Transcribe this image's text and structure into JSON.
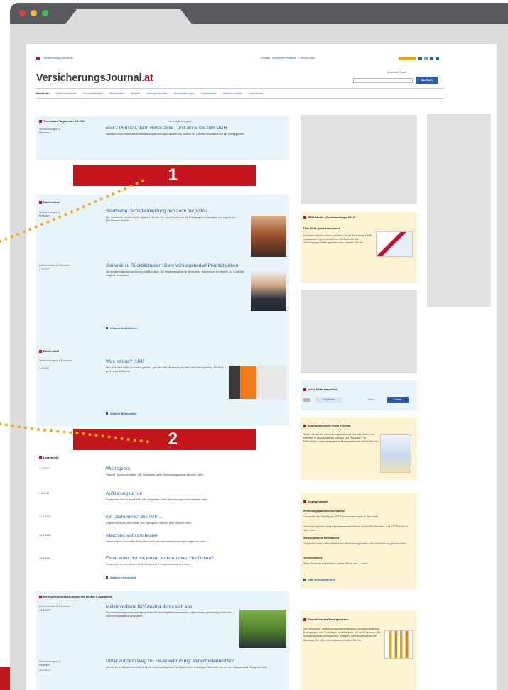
{
  "browser": {
    "dots": [
      "#e03c3c",
      "#f5b63a",
      "#3fbf55"
    ]
  },
  "site": {
    "logo_main": "VersicherungsJournal",
    "logo_suffix": ".at",
    "url_text": "VersicherungsJournal.de",
    "top_links": "Kontakt   Newsletter bestellen   Premium-Abo",
    "nav": [
      "Startseite",
      "Themenbereiche",
      "Pressestimmen",
      "Bilder/Video",
      "Bücher",
      "Anzeigenmärkte",
      "Veranstaltungen",
      "Originaltexte",
      "Weitere Inhalte",
      "Leserbriefe"
    ],
    "search_button": "Suchen",
    "search_hint": "Erweiterte Suche"
  },
  "theme_of_day": {
    "header": "Thema des Tages vom 3.2.2017",
    "header_link": "vorherige Ausgabe",
    "category": "Versicherungen & Finanzen",
    "title": "Erst 1 Pension, dann Reha-Geld – und am Ende zum OGH",
    "text": "Nachdem einem Mann das Rehabilitationsgeld entzogen worden war, musste der Oberste Gerichtshof nun ein Stichtag prüfen."
  },
  "markers": [
    "1",
    "2"
  ],
  "news": {
    "header": "Nachrichten",
    "items": [
      {
        "category": "Versicherungen & Finanzen",
        "title": "Städtische: Schadenmeldung nun auch per Video",
        "text": "Der Versicherer erweitert seine digitalen Dienste. Der neue Service soll die Erledigung beschleunigen und ergänzt den persönlichen Kontakt."
      },
      {
        "category": "Unternehmen & Personen",
        "date": "3.2.2017",
        "title": "Generali zu Rückbildbedarf: Dem Vorsorgebedarf Priorität geben",
        "text": "Die jüngste Kalkulationsrechnung und Rückblick. Die Regierungspläne für Versicherer. Neuerungen im Vertrieb 2017 und eine mögliche Konkurrenz."
      }
    ],
    "more": "Weitere Nachrichten"
  },
  "riddle": {
    "header": "Bilderrätsel",
    "category": "Versicherungen & Finanzen",
    "date": "1.2.2017",
    "title": "Was ist das? (184)",
    "text": "Hier sind keine Bilder zu erraten gekauft – gesucht wird aber etwas aus dem Versicherungsalltag. Per Klick geht es zur Auflösung.",
    "more": "Weitere Bilderrätsel"
  },
  "letters": {
    "header": "Leserbriefe",
    "items": [
      {
        "date": "1.2.2017",
        "title": "Wichtigeres",
        "text": "Gesucht: Suche zum Artikel „Wir: Bürgerliste sollen Versicherungsschutz anbieten“ mehr …"
      },
      {
        "date": "1.2.2017",
        "title": "Aufklärung tut not",
        "text": "Ergebnisse: Lindner zum Artikel „Wir: Bürgerliste sollen Versicherungsschutz anbieten“ mehr …"
      },
      {
        "date": "31.1.2017",
        "title": "Ein „Geheimnis“ des VAV ...",
        "text": "Engelbert Kreuzer zum Artikel „VAV: Bausparen Jahrin in jeder Hinsicht“ mehr …"
      },
      {
        "date": "30.1.2017",
        "title": "Abschied wohl am besten",
        "text": "Hannes Hesch zum Artikel „Rücktrittsrecht: Erste Gerichtsentscheidungen liegen vor“ mehr …"
      },
      {
        "date": "30.1.2017",
        "title": "Einen alten Hut mit einem anderen alten Hut flicken?",
        "text": "Christoph Leist zum Artikel „Streik“-Erfolg neue Fondspolizzenbranche mehr …"
      }
    ],
    "more": "Weitere Leserbriefe"
  },
  "most_read": {
    "header": "Meistgelesene Nachrichten der letzten 5 Ausgaben",
    "items": [
      {
        "category": "Unternehmen & Personen",
        "date": "31.1.2017",
        "title": "Maklerverbund IGV Austria dehnt sich aus",
        "text": "Die Versicherungsmaklervereinigung hat zwölf neue Mitgliedsunternehmen aufgenommen, gleichzeitig wurde eine neue Teilorganisation geschaffen."
      },
      {
        "category": "Versicherungen & Finanzen",
        "date": "30.1.2017",
        "title": "Unfall auf dem Weg zur Feuerwehrübung: Versichertenrechte?",
        "text": "Das AVHO stellt bestimmte Unfälle einem Arbeitsunfall gleich. Ein Mitglied einer freiwilligen Feuerwehr war auf dem Weg zu einer Übung verunfallt."
      }
    ]
  },
  "sidebar": {
    "study": {
      "header": "MSU Studie „Gehaltsumfrage 2016“",
      "subhead": "Über Geld spricht man nicht",
      "text": "Dennoch will man wissen, welches Gehalt die Kollege erhält und was die eigene Arbeit dem Chef wert ist. Wie Versicherungsmakler gesehen wird, erfahren Sie hier …"
    },
    "recommend": {
      "header": "Diese Seite empfehlen",
      "buttons": [
        "Empfehlen",
        "Tweet",
        "Share"
      ]
    },
    "survey": {
      "header": "Assekuranzrecht reden Technik",
      "text": "Wohin steuert die Versicherungswirtschaft und was planen Ihre Manager in puncto Vertrieb, Service und Produkte? Für Entscheider in den strategischen Planungsebenen klicken Sie hier …"
    },
    "market": {
      "header": "Anzeigenmarkt",
      "items": [
        "Rechnungsplanerin/Innendienst",
        "Gesucht in der Top-Region KFZ-Sachversicherungen in Tirol mehr …",
        "Versicherungsbüro sucht Innendienstmitarbeiter/in für den Privatkunden- und KFZ-Bereich in Wien mehr …",
        "Stellengesuche Innendienst",
        "Tätigkeit im Back-Office Bereich bei Versicherungsmakler oder Versicherung gesucht mehr …",
        "Verschiedenes",
        "Wenn Sie anderen inserieren, sehen Sie zu uns … mehr …"
      ],
      "more": "Zum Anzeigenmarkt"
    },
    "fund": {
      "header": "Einmaleins der Fondspolizzen",
      "text": "Die rechtlichen, versicherungsmathematischen und wirtschaftlichen Bedingungen des Produkttyps sind komplex. Mit dem Fachbuch „Die fondsgebundene Versicherung“ erweitern Sie Fachwissen für die Beratung. Die Mehr Informationen erhalten Sie hier."
    }
  }
}
